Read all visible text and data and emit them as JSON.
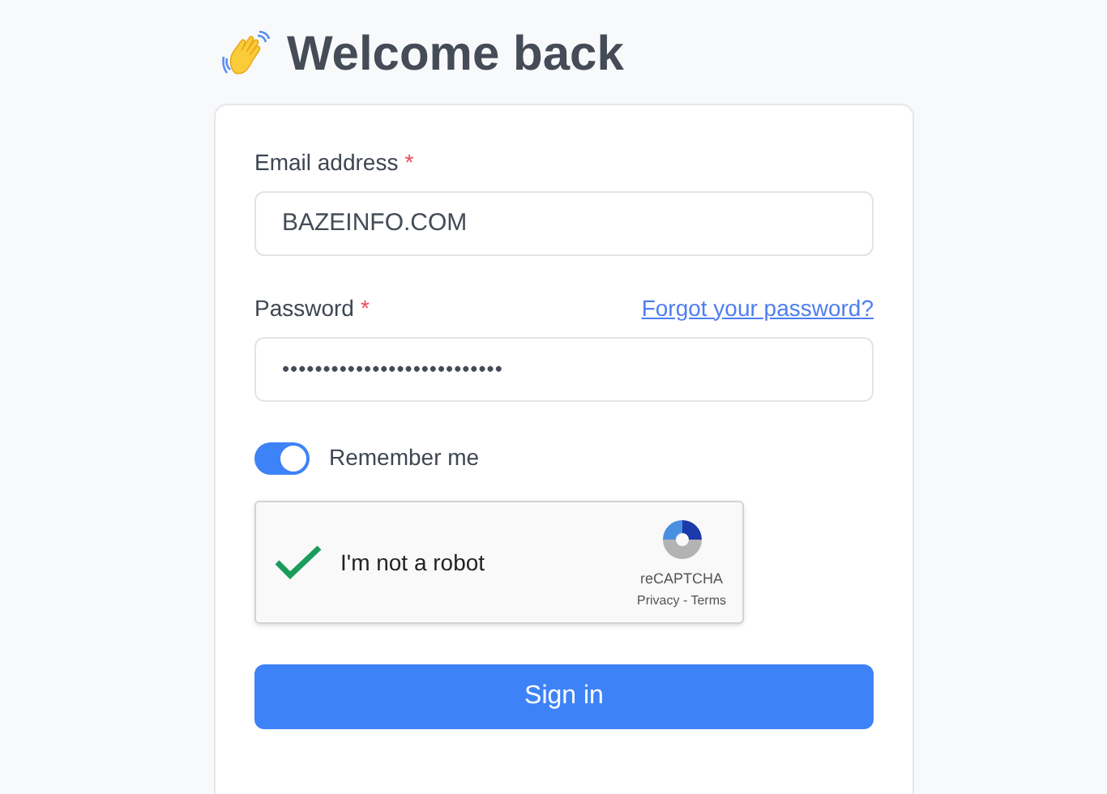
{
  "title": "Welcome back",
  "email": {
    "label": "Email address",
    "required_mark": "*",
    "value": "BAZEINFO.COM"
  },
  "password": {
    "label": "Password",
    "required_mark": "*",
    "forgot_link": "Forgot your password?",
    "value": "•••••••••••••••••••••••••••"
  },
  "remember": {
    "label": "Remember me",
    "on": true
  },
  "captcha": {
    "label": "I'm not a robot",
    "checked": true,
    "brand": "reCAPTCHA",
    "links": "Privacy - Terms"
  },
  "submit": "Sign in"
}
